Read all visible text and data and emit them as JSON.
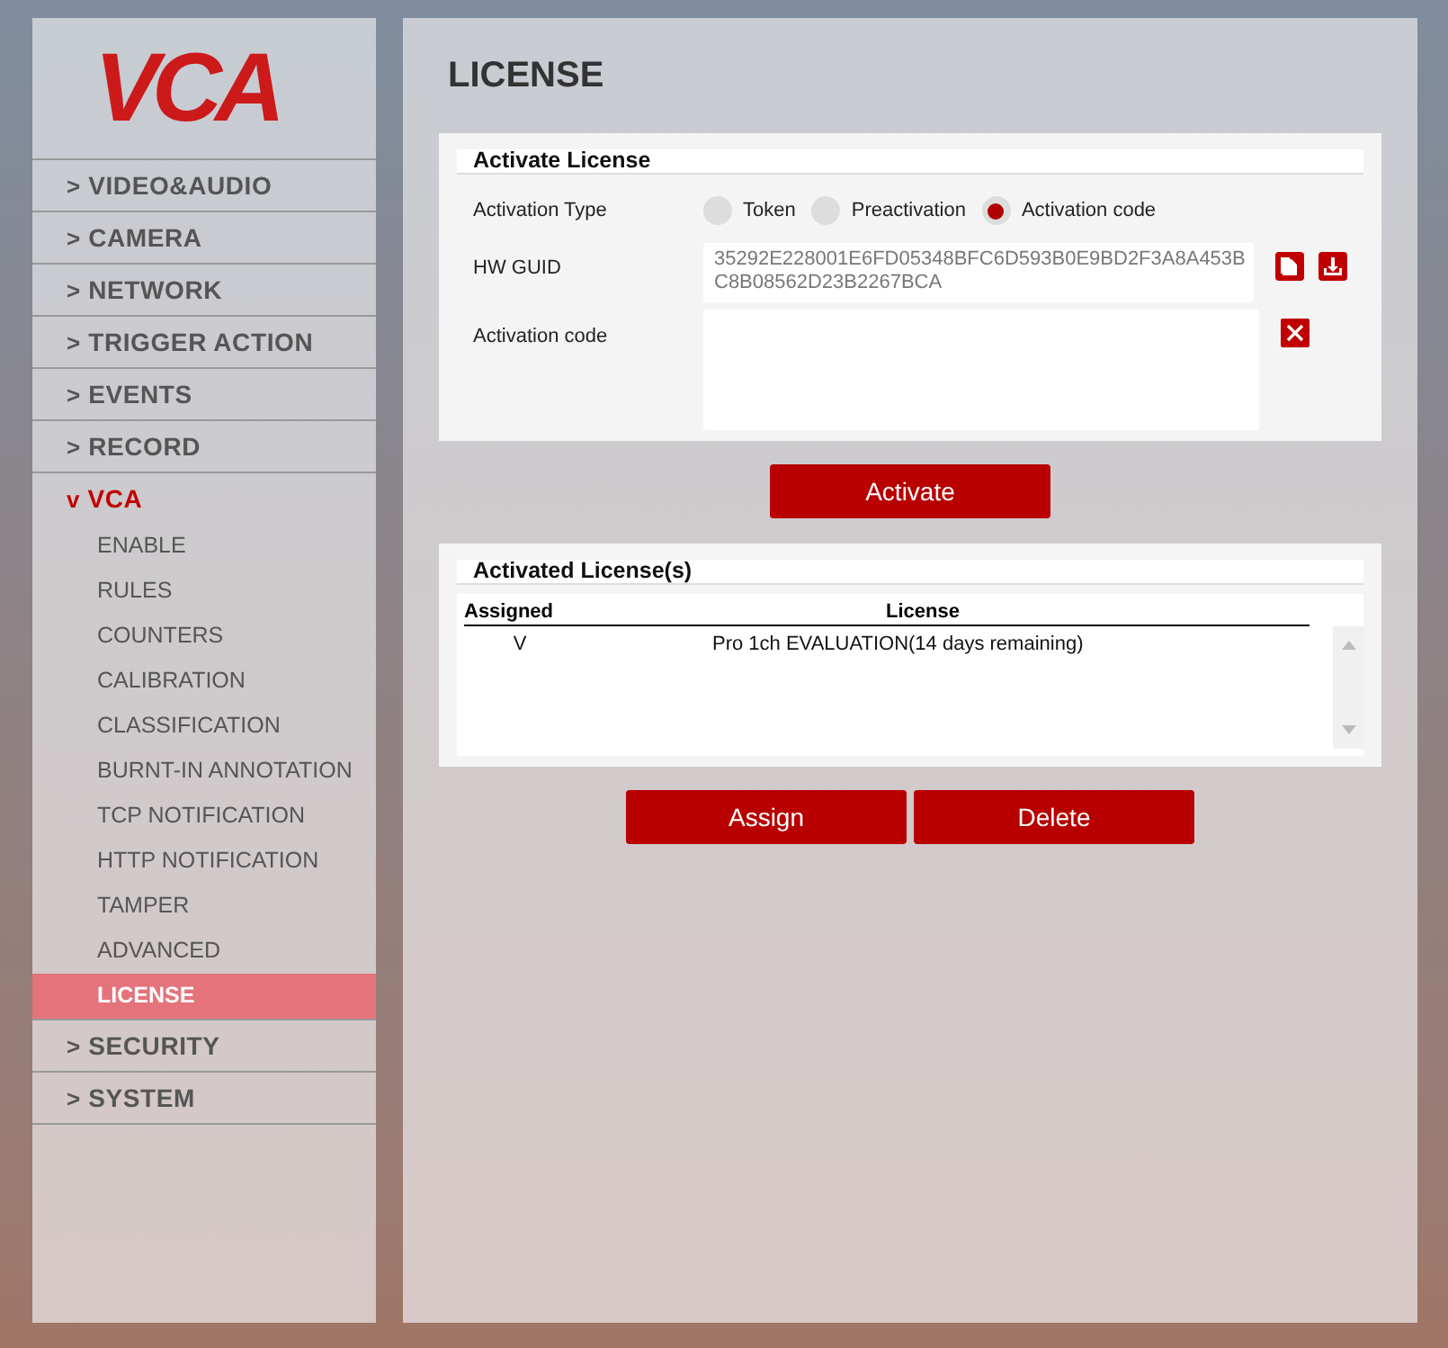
{
  "logo": {
    "text": "VCA"
  },
  "sidebar": {
    "items": [
      {
        "marker": ">",
        "label": "VIDEO&AUDIO",
        "expanded": false
      },
      {
        "marker": ">",
        "label": "CAMERA",
        "expanded": false
      },
      {
        "marker": ">",
        "label": "NETWORK",
        "expanded": false
      },
      {
        "marker": ">",
        "label": "TRIGGER ACTION",
        "expanded": false
      },
      {
        "marker": ">",
        "label": "EVENTS",
        "expanded": false
      },
      {
        "marker": ">",
        "label": "RECORD",
        "expanded": false
      },
      {
        "marker": "v",
        "label": "VCA",
        "expanded": true,
        "children": [
          {
            "label": "ENABLE",
            "selected": false
          },
          {
            "label": "RULES",
            "selected": false
          },
          {
            "label": "COUNTERS",
            "selected": false
          },
          {
            "label": "CALIBRATION",
            "selected": false
          },
          {
            "label": "CLASSIFICATION",
            "selected": false
          },
          {
            "label": "BURNT-IN ANNOTATION",
            "selected": false
          },
          {
            "label": "TCP NOTIFICATION",
            "selected": false
          },
          {
            "label": "HTTP NOTIFICATION",
            "selected": false
          },
          {
            "label": "TAMPER",
            "selected": false
          },
          {
            "label": "ADVANCED",
            "selected": false
          },
          {
            "label": "LICENSE",
            "selected": true
          }
        ]
      },
      {
        "marker": ">",
        "label": "SECURITY",
        "expanded": false
      },
      {
        "marker": ">",
        "label": "SYSTEM",
        "expanded": false
      }
    ]
  },
  "page": {
    "title": "LICENSE"
  },
  "activate": {
    "title": "Activate License",
    "type_label": "Activation Type",
    "options": [
      {
        "label": "Token",
        "selected": false
      },
      {
        "label": "Preactivation",
        "selected": false
      },
      {
        "label": "Activation code",
        "selected": true
      }
    ],
    "guid_label": "HW GUID",
    "guid": "35292E228001E6FD05348BFC6D593B0E9BD2F3A8A453BC8B08562D23B2267BCA",
    "code_label": "Activation code",
    "button": "Activate"
  },
  "licenses": {
    "title": "Activated License(s)",
    "columns": [
      "Assigned",
      "License"
    ],
    "rows": [
      {
        "assigned": "V",
        "license": "Pro 1ch EVALUATION(14 days remaining)"
      }
    ],
    "buttons": [
      "Assign",
      "Delete"
    ]
  }
}
